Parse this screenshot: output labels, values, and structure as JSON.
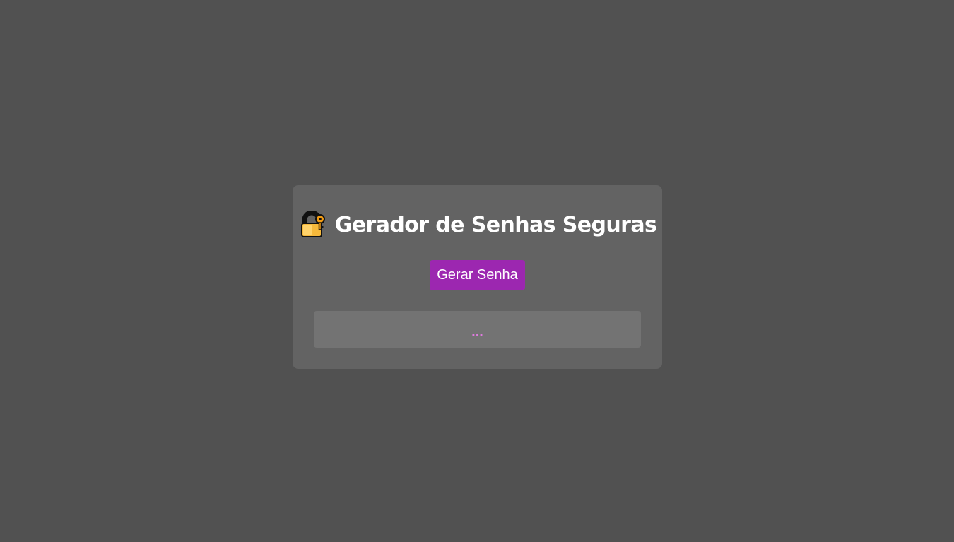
{
  "app": {
    "title": "Gerador de Senhas Seguras",
    "title_icon": "locked-with-key-icon"
  },
  "controls": {
    "generate_label": "Gerar Senha"
  },
  "result": {
    "value": "..."
  },
  "colors": {
    "page_background": "#515151",
    "card_background": "#636363",
    "button_background": "#9c27b0",
    "result_background": "#737373",
    "result_text": "#e07be0"
  }
}
